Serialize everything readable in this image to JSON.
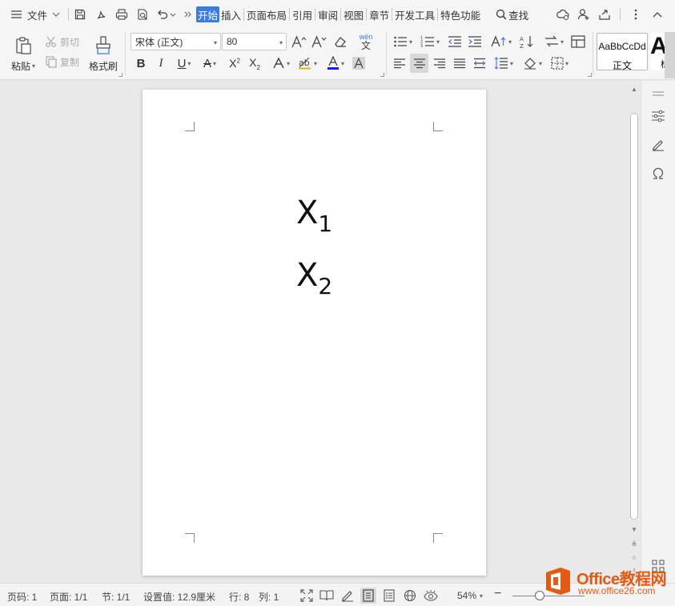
{
  "menubar": {
    "file_label": "文件",
    "tabs": [
      "开始",
      "插入",
      "页面布局",
      "引用",
      "审阅",
      "视图",
      "章节",
      "开发工具",
      "特色功能"
    ],
    "active_tab": "开始",
    "search_label": "查找"
  },
  "ribbon": {
    "paste_label": "粘贴",
    "cut_label": "剪切",
    "copy_label": "复制",
    "format_painter_label": "格式刷",
    "font_name": "宋体 (正文)",
    "font_size": "80",
    "style_preview": "AaBbCcDd",
    "style_name": "正文",
    "next_style_preview": "A",
    "next_style_name_fragment": "标",
    "phonetic_glyph": "wén"
  },
  "document": {
    "lines": [
      {
        "base": "X",
        "sub": "1"
      },
      {
        "base": "X",
        "sub": "2"
      }
    ]
  },
  "statusbar": {
    "page_number": "页码: 1",
    "page_count": "页面: 1/1",
    "section": "节: 1/1",
    "position": "设置值: 12.9厘米",
    "line": "行: 8",
    "column": "列: 1",
    "zoom": "54%"
  },
  "watermark": {
    "title": "Office教程网",
    "url": "www.office26.com"
  },
  "colors": {
    "accent": "#3b7ddd",
    "font_color_bar": "#1a1aff",
    "watermark": "#e35a12"
  }
}
